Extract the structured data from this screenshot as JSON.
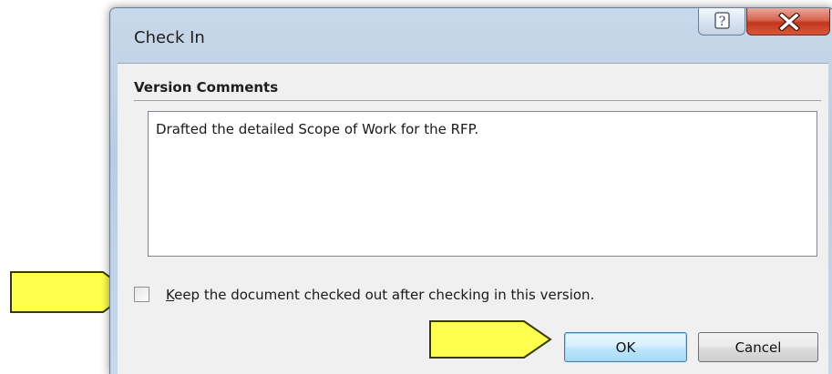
{
  "dialog": {
    "title": "Check In",
    "help_icon": "help-icon",
    "close_icon": "close-icon"
  },
  "version_comments": {
    "label": "Version Comments",
    "value": "Drafted the detailed Scope of Work for the RFP."
  },
  "keep_checked_out": {
    "label_mnemonic": "K",
    "label_rest": "eep the document checked out after checking in this version.",
    "checked": false
  },
  "buttons": {
    "ok_label": "OK",
    "cancel_label": "Cancel"
  },
  "annotations": {
    "arrow_color": "#ffff4d",
    "arrow_outline": "#3a3a00"
  }
}
